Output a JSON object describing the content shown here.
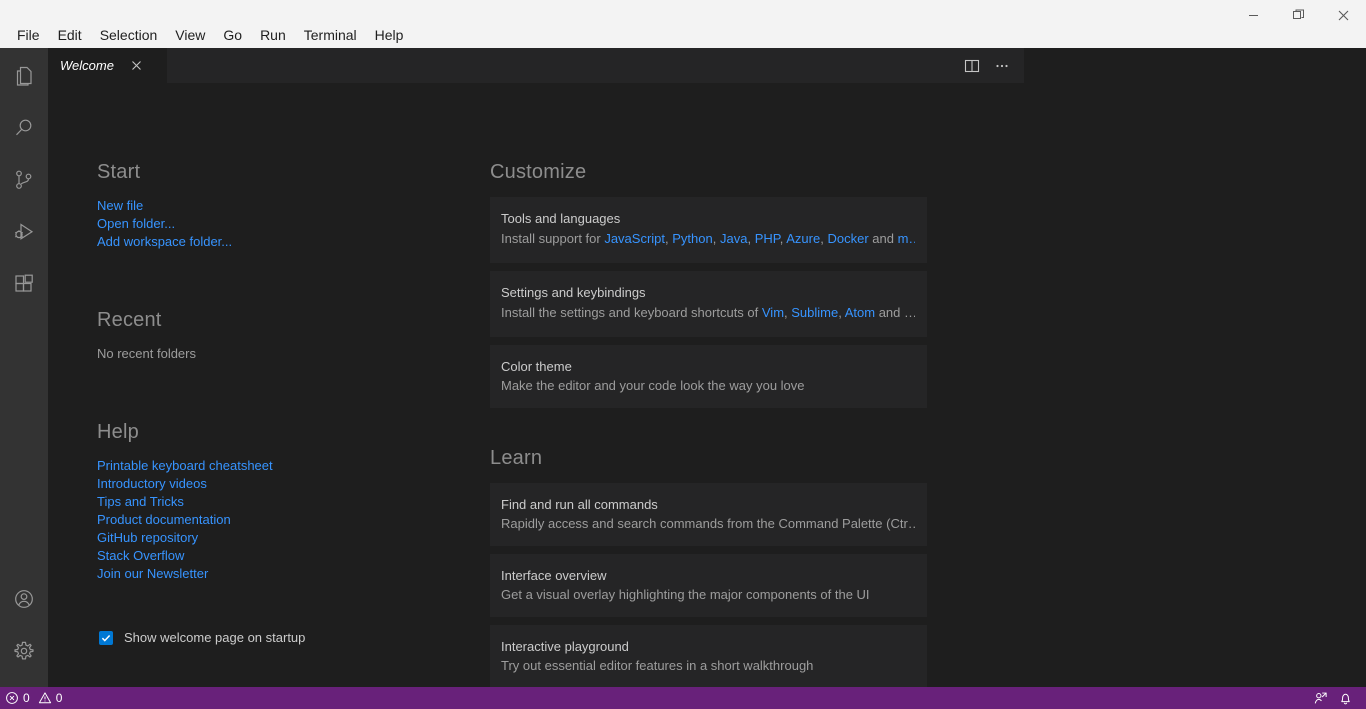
{
  "window": {
    "controls": [
      {
        "name": "minimize",
        "icon": "minimize-icon"
      },
      {
        "name": "restore",
        "icon": "restore-icon"
      },
      {
        "name": "close",
        "icon": "close-icon"
      }
    ]
  },
  "menubar": {
    "items": [
      {
        "label": "File"
      },
      {
        "label": "Edit"
      },
      {
        "label": "Selection"
      },
      {
        "label": "View"
      },
      {
        "label": "Go"
      },
      {
        "label": "Run"
      },
      {
        "label": "Terminal"
      },
      {
        "label": "Help"
      }
    ]
  },
  "activitybar": {
    "top": [
      {
        "name": "explorer",
        "icon": "files-icon"
      },
      {
        "name": "search",
        "icon": "search-icon"
      },
      {
        "name": "source-control",
        "icon": "source-control-icon"
      },
      {
        "name": "run-and-debug",
        "icon": "run-debug-icon"
      },
      {
        "name": "extensions",
        "icon": "extensions-icon"
      }
    ],
    "bottom": [
      {
        "name": "accounts",
        "icon": "account-icon"
      },
      {
        "name": "manage",
        "icon": "gear-icon"
      }
    ]
  },
  "editor": {
    "tab": {
      "label": "Welcome",
      "close_icon": "close-icon"
    },
    "actions": [
      {
        "name": "split-editor",
        "icon": "split-editor-icon"
      },
      {
        "name": "more-actions",
        "icon": "ellipsis-icon"
      }
    ]
  },
  "welcome": {
    "start": {
      "title": "Start",
      "links": [
        {
          "label": "New file"
        },
        {
          "label": "Open folder..."
        },
        {
          "label": "Add workspace folder..."
        }
      ]
    },
    "recent": {
      "title": "Recent",
      "empty_text": "No recent folders"
    },
    "help": {
      "title": "Help",
      "links": [
        {
          "label": "Printable keyboard cheatsheet"
        },
        {
          "label": "Introductory videos"
        },
        {
          "label": "Tips and Tricks"
        },
        {
          "label": "Product documentation"
        },
        {
          "label": "GitHub repository"
        },
        {
          "label": "Stack Overflow"
        },
        {
          "label": "Join our Newsletter"
        }
      ]
    },
    "startup": {
      "checked": true,
      "label": "Show welcome page on startup"
    },
    "customize": {
      "title": "Customize",
      "cards": [
        {
          "title": "Tools and languages",
          "desc_prefix": "Install support for ",
          "links": [
            "JavaScript",
            "Python",
            "Java",
            "PHP",
            "Azure",
            "Docker"
          ],
          "desc_middle": " and ",
          "desc_suffix_link": "m…"
        },
        {
          "title": "Settings and keybindings",
          "desc_prefix": "Install the settings and keyboard shortcuts of ",
          "links": [
            "Vim",
            "Sublime",
            "Atom"
          ],
          "desc_middle": " and ",
          "desc_suffix": "…"
        },
        {
          "title": "Color theme",
          "desc": "Make the editor and your code look the way you love"
        }
      ]
    },
    "learn": {
      "title": "Learn",
      "cards": [
        {
          "title": "Find and run all commands",
          "desc": "Rapidly access and search commands from the Command Palette (Ctr…"
        },
        {
          "title": "Interface overview",
          "desc": "Get a visual overlay highlighting the major components of the UI"
        },
        {
          "title": "Interactive playground",
          "desc": "Try out essential editor features in a short walkthrough"
        }
      ]
    }
  },
  "statusbar": {
    "background": "#68217a",
    "errors": "0",
    "warnings": "0",
    "right": [
      {
        "name": "feedback",
        "icon": "feedback-icon"
      },
      {
        "name": "notifications",
        "icon": "bell-icon"
      }
    ]
  },
  "colors": {
    "link": "#3794ff",
    "accent": "#0078d4",
    "editor_bg": "#1e1e1e",
    "card_bg": "#252526",
    "activity_bg": "#333333",
    "titlebar_bg": "#f3f3f3"
  }
}
